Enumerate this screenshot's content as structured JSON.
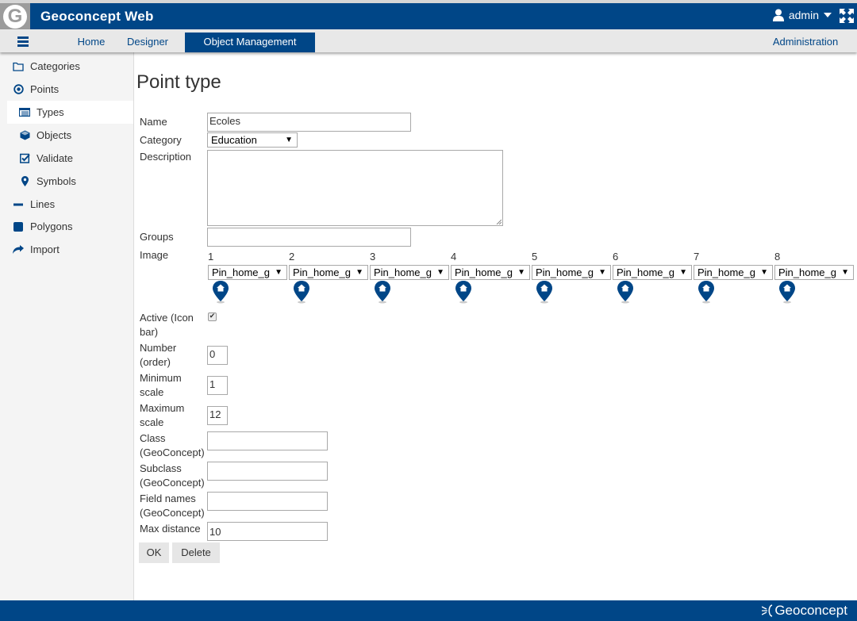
{
  "header": {
    "logo_letter": "G",
    "app_title": "Geoconcept Web",
    "user_label": "admin"
  },
  "navbar": {
    "tabs": [
      {
        "label": "Home",
        "active": false
      },
      {
        "label": "Designer",
        "active": false
      },
      {
        "label": "Object Management",
        "active": true
      }
    ],
    "admin_label": "Administration"
  },
  "sidebar": {
    "items": [
      {
        "label": "Categories",
        "icon": "folder-icon"
      },
      {
        "label": "Points",
        "icon": "dot-circle-icon"
      },
      {
        "label": "Types",
        "icon": "list-icon",
        "active": true
      },
      {
        "label": "Objects",
        "icon": "cube-icon"
      },
      {
        "label": "Validate",
        "icon": "check-square-icon"
      },
      {
        "label": "Symbols",
        "icon": "map-marker-icon"
      },
      {
        "label": "Lines",
        "icon": "minus-icon"
      },
      {
        "label": "Polygons",
        "icon": "square-icon"
      },
      {
        "label": "Import",
        "icon": "share-icon"
      }
    ]
  },
  "form": {
    "title": "Point type",
    "name_label": "Name",
    "name_value": "Ecoles",
    "category_label": "Category",
    "category_value": "Education",
    "description_label": "Description",
    "description_value": "",
    "groups_label": "Groups",
    "groups_value": "",
    "image_label": "Image",
    "images": [
      {
        "index": "1",
        "value": "Pin_home_g"
      },
      {
        "index": "2",
        "value": "Pin_home_g"
      },
      {
        "index": "3",
        "value": "Pin_home_g"
      },
      {
        "index": "4",
        "value": "Pin_home_g"
      },
      {
        "index": "5",
        "value": "Pin_home_g"
      },
      {
        "index": "6",
        "value": "Pin_home_g"
      },
      {
        "index": "7",
        "value": "Pin_home_g"
      },
      {
        "index": "8",
        "value": "Pin_home_g"
      }
    ],
    "active_label": "Active (Icon bar)",
    "active_checked": true,
    "number_label": "Number (order)",
    "number_value": "0",
    "min_scale_label": "Minimum scale",
    "min_scale_value": "1",
    "max_scale_label": "Maximum scale",
    "max_scale_value": "12",
    "class_label": "Class (GeoConcept)",
    "class_value": "",
    "subclass_label": "Subclass (GeoConcept)",
    "subclass_value": "",
    "fieldnames_label": "Field names (GeoConcept)",
    "fieldnames_value": "",
    "maxdist_label": "Max distance",
    "maxdist_value": "10",
    "ok_label": "OK",
    "delete_label": "Delete"
  },
  "footer": {
    "brand": "Geoconcept"
  },
  "colors": {
    "brand": "#004687",
    "logo_gray": "#9c9c9c"
  }
}
